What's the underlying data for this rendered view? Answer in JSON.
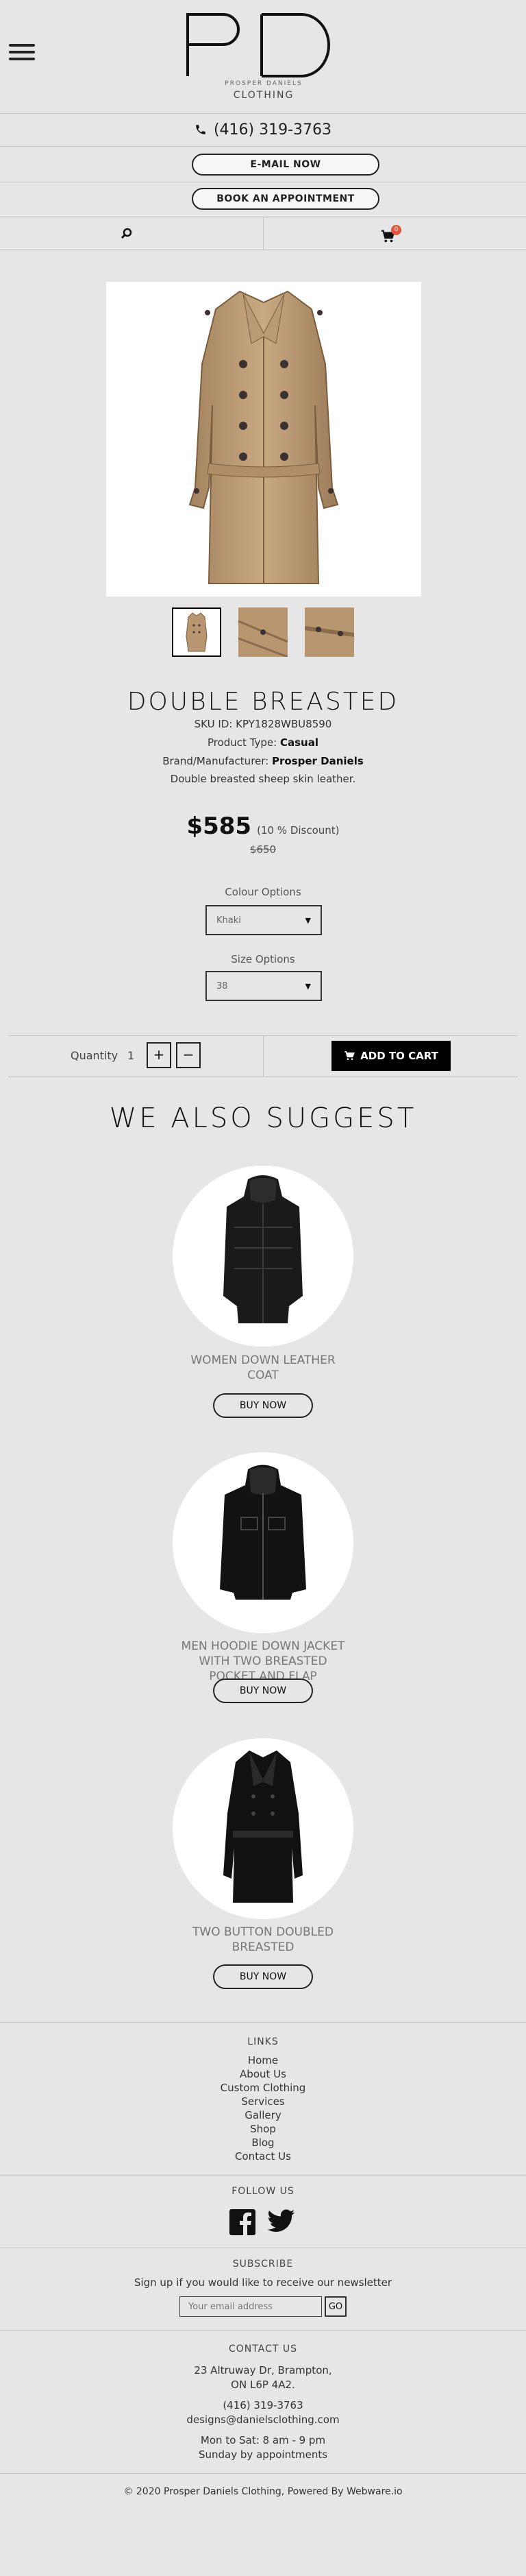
{
  "header": {
    "logo_sub": "PROSPER DANIELS",
    "logo_text": "CLOTHING",
    "phone": "(416) 319-3763",
    "email_btn": "E-MAIL NOW",
    "appointment_btn": "BOOK AN APPOINTMENT",
    "cart_count": "0"
  },
  "product": {
    "title": "DOUBLE BREASTED",
    "sku_label": "SKU ID: ",
    "sku": "KPY1828WBU8590",
    "type_label": "Product Type: ",
    "type": "Casual",
    "brand_label": "Brand/Manufacturer: ",
    "brand": "Prosper Daniels",
    "description": "Double breasted sheep skin leather.",
    "price": "$585",
    "discount": "(10 % Discount)",
    "old_price": "$650",
    "colour_label": "Colour Options",
    "colour_value": "Khaki",
    "size_label": "Size Options",
    "size_value": "38",
    "quantity_label": "Quantity",
    "quantity_value": "1",
    "plus": "+",
    "minus": "−",
    "add_to_cart": "ADD TO CART"
  },
  "suggest": {
    "heading": "WE ALSO SUGGEST",
    "items": [
      {
        "name": "WOMEN DOWN LEATHER COAT",
        "button": "BUY NOW"
      },
      {
        "name": "MEN HOODIE DOWN JACKET WITH TWO BREASTED POCKET AND FLAP",
        "button": "BUY NOW"
      },
      {
        "name": "TWO BUTTON DOUBLED BREASTED",
        "button": "BUY NOW"
      }
    ]
  },
  "footer": {
    "links_heading": "LINKS",
    "links": [
      "Home",
      "About Us",
      "Custom Clothing",
      "Services",
      "Gallery",
      "Shop",
      "Blog",
      "Contact Us"
    ],
    "follow_heading": "FOLLOW US",
    "subscribe_heading": "SUBSCRIBE",
    "subscribe_text": "Sign up if you would like to receive our newsletter",
    "email_placeholder": "Your email address",
    "go_btn": "GO",
    "contact_heading": "CONTACT US",
    "address1": "23 Altruway Dr, Brampton,",
    "address2": "ON L6P 4A2.",
    "phone": "(416) 319-3763",
    "email": "designs@danielsclothing.com",
    "hours1": "Mon to Sat: 8 am - 9 pm",
    "hours2": "Sunday by appointments",
    "copyright": "© 2020 Prosper Daniels Clothing, Powered By Webware.io"
  },
  "colors": {
    "accent": "#e5533d",
    "background": "#e6e6e6",
    "button_dark": "#000000"
  }
}
